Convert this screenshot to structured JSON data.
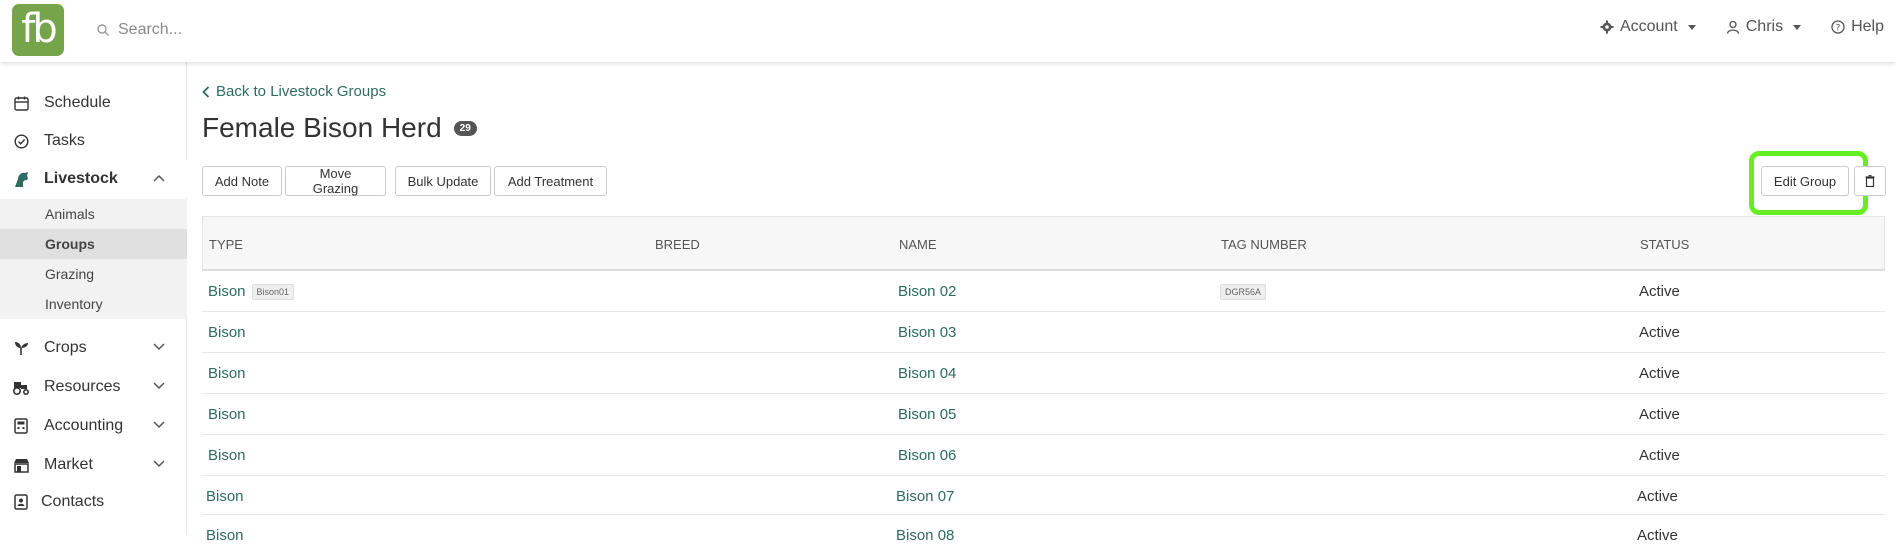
{
  "header": {
    "logo_text": "fb",
    "search_placeholder": "Search...",
    "account_label": "Account",
    "user_label": "Chris",
    "help_label": "Help"
  },
  "sidebar": {
    "items": [
      {
        "label": "Schedule",
        "icon": "calendar-icon"
      },
      {
        "label": "Tasks",
        "icon": "check-circle-icon"
      },
      {
        "label": "Livestock",
        "icon": "horse-icon"
      },
      {
        "label": "Crops",
        "icon": "seedling-icon"
      },
      {
        "label": "Resources",
        "icon": "tractor-icon"
      },
      {
        "label": "Accounting",
        "icon": "calculator-icon"
      },
      {
        "label": "Market",
        "icon": "store-icon"
      },
      {
        "label": "Contacts",
        "icon": "contact-icon"
      }
    ],
    "livestock_sub": [
      "Animals",
      "Groups",
      "Grazing",
      "Inventory"
    ]
  },
  "page": {
    "back_label": "Back to Livestock Groups",
    "title": "Female Bison Herd",
    "count": "29"
  },
  "actions": {
    "add_note": "Add Note",
    "move_grazing": "Move Grazing",
    "bulk_update": "Bulk Update",
    "add_treatment": "Add Treatment",
    "edit_group": "Edit Group",
    "delete_icon": "trash-icon"
  },
  "table": {
    "columns": [
      "TYPE",
      "BREED",
      "NAME",
      "TAG NUMBER",
      "STATUS"
    ],
    "rows": [
      {
        "type": "Bison",
        "type_tag": "Bison01",
        "breed": "",
        "name": "Bison 02",
        "tag": "DGR56A",
        "status": "Active"
      },
      {
        "type": "Bison",
        "type_tag": "",
        "breed": "",
        "name": "Bison 03",
        "tag": "",
        "status": "Active"
      },
      {
        "type": "Bison",
        "type_tag": "",
        "breed": "",
        "name": "Bison 04",
        "tag": "",
        "status": "Active"
      },
      {
        "type": "Bison",
        "type_tag": "",
        "breed": "",
        "name": "Bison 05",
        "tag": "",
        "status": "Active"
      },
      {
        "type": "Bison",
        "type_tag": "",
        "breed": "",
        "name": "Bison 06",
        "tag": "",
        "status": "Active"
      },
      {
        "type": "Bison",
        "type_tag": "",
        "breed": "",
        "name": "Bison 07",
        "tag": "",
        "status": "Active"
      },
      {
        "type": "Bison",
        "type_tag": "",
        "breed": "",
        "name": "Bison 08",
        "tag": "",
        "status": "Active"
      }
    ]
  },
  "colors": {
    "brand": "#75a44a",
    "link": "#2f6b5e",
    "highlight": "#66ee22"
  }
}
